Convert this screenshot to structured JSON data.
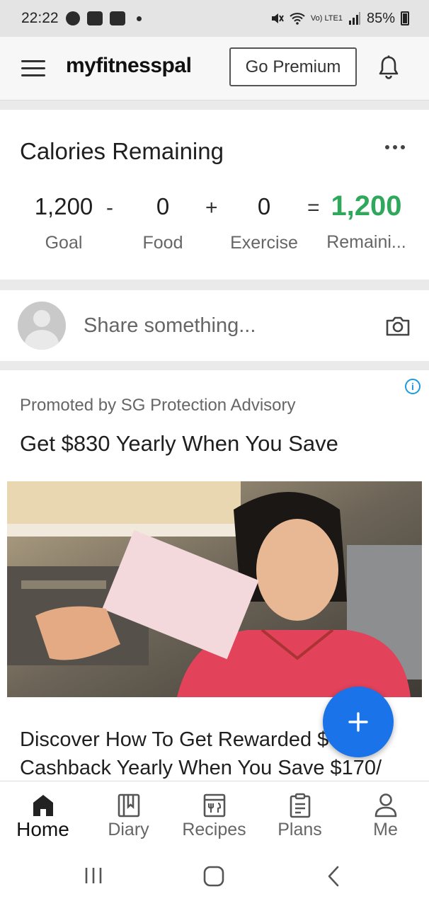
{
  "status": {
    "time": "22:22",
    "battery": "85%",
    "network": "Vo) LTE1"
  },
  "header": {
    "brand": "myfitnesspal",
    "premium_label": "Go Premium"
  },
  "calories": {
    "title": "Calories Remaining",
    "goal": {
      "value": "1,200",
      "label": "Goal"
    },
    "food": {
      "value": "0",
      "label": "Food"
    },
    "exercise": {
      "value": "0",
      "label": "Exercise"
    },
    "remaining": {
      "value": "1,200",
      "label": "Remaini..."
    },
    "op_minus": "-",
    "op_plus": "+",
    "op_equals": "=",
    "accent": "#2fa85b"
  },
  "share": {
    "placeholder": "Share something..."
  },
  "ad": {
    "promoted": "Promoted by SG Protection Advisory",
    "headline": "Get $830 Yearly When You Save",
    "body_line1": "Discover How To Get Rewarded $",
    "body_line2": "Cashback Yearly When You Save $170/",
    "info_icon": "info-icon"
  },
  "fab": {
    "label": "+",
    "color": "#1a73e8"
  },
  "nav": [
    {
      "label": "Home",
      "icon": "home-icon"
    },
    {
      "label": "Diary",
      "icon": "diary-icon"
    },
    {
      "label": "Recipes",
      "icon": "recipes-icon"
    },
    {
      "label": "Plans",
      "icon": "plans-icon"
    },
    {
      "label": "Me",
      "icon": "profile-icon"
    }
  ]
}
